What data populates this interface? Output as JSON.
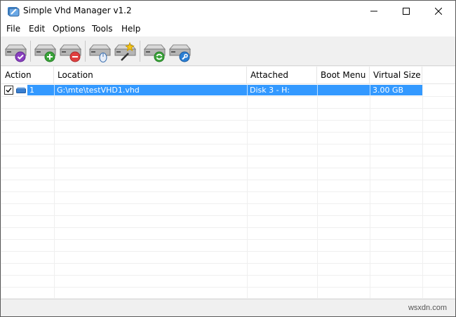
{
  "window": {
    "title": "Simple Vhd Manager v1.2"
  },
  "menu": {
    "items": [
      {
        "label": "File"
      },
      {
        "label": "Edit"
      },
      {
        "label": "Options"
      },
      {
        "label": "Tools"
      },
      {
        "label": "Help"
      }
    ]
  },
  "toolbar": {
    "buttons": [
      {
        "icon": "disk-check-icon"
      },
      {
        "icon": "disk-add-icon"
      },
      {
        "icon": "disk-remove-icon"
      },
      {
        "icon": "disk-mouse-icon"
      },
      {
        "icon": "disk-wand-icon"
      },
      {
        "icon": "disk-refresh-icon"
      },
      {
        "icon": "disk-settings-icon"
      }
    ]
  },
  "list": {
    "columns": [
      "Action",
      "Location",
      "Attached",
      "Boot Menu",
      "Virtual Size"
    ],
    "rows": [
      {
        "action": "1",
        "location": "G:\\mte\\testVHD1.vhd",
        "attached": "Disk 3  -  H:",
        "boot_menu": "",
        "virtual_size": "3.00 GB",
        "checked": true,
        "selected": true
      }
    ]
  },
  "statusbar": {
    "watermark": "wsxdn.com"
  },
  "colors": {
    "selection": "#3399ff",
    "add_green": "#3aa43a",
    "remove_red": "#e04040",
    "check_purple": "#8a3fbf",
    "settings_blue": "#2a7fd4"
  }
}
